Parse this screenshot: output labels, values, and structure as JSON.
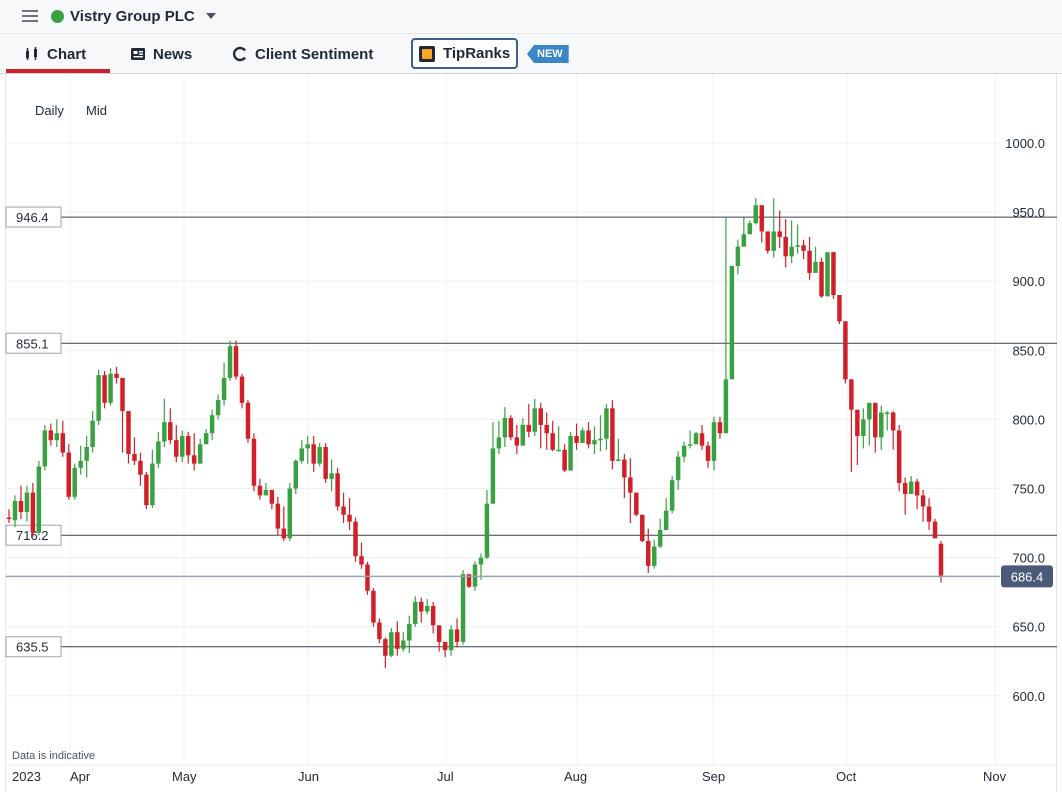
{
  "header": {
    "instrument": "Vistry Group PLC",
    "status_color": "#3aa142"
  },
  "tabs": [
    {
      "label": "Chart",
      "icon": "candlestick-icon",
      "active": true
    },
    {
      "label": "News",
      "icon": "newspaper-icon"
    },
    {
      "label": "Client Sentiment",
      "icon": "sentiment-icon"
    },
    {
      "label": "TipRanks",
      "icon": "tipranks-logo-icon"
    }
  ],
  "new_badge": "NEW",
  "toolbar": {
    "interval": "Daily",
    "price_type": "Mid"
  },
  "disclaimer": "Data is indicative",
  "chart_data": {
    "type": "candlestick",
    "year_label": "2023",
    "x_labels": [
      "Apr",
      "May",
      "Jun",
      "Jul",
      "Aug",
      "Sep",
      "Oct",
      "Nov"
    ],
    "y_ticks": [
      "600.0",
      "650.0",
      "700.0",
      "750.0",
      "800.0",
      "850.0",
      "900.0",
      "950.0",
      "1000.0"
    ],
    "ylim": [
      600,
      1000
    ],
    "horizontal_lines": [
      {
        "label": "946.4",
        "value": 946.4
      },
      {
        "label": "855.1",
        "value": 855.1
      },
      {
        "label": "716.2",
        "value": 716.2
      },
      {
        "label": "635.5",
        "value": 635.5
      }
    ],
    "last_price": {
      "label": "686.4",
      "value": 686.4
    },
    "colors": {
      "up": "#3aa142",
      "down": "#d0202a",
      "last_price_bg": "#4a5a78"
    },
    "candles": [
      [
        729,
        728,
        735,
        725
      ],
      [
        727,
        741,
        745,
        722
      ],
      [
        741,
        733,
        752,
        728
      ],
      [
        733,
        747,
        752,
        726
      ],
      [
        747,
        718,
        754,
        715
      ],
      [
        718,
        766,
        770,
        716
      ],
      [
        766,
        792,
        796,
        763
      ],
      [
        792,
        785,
        797,
        781
      ],
      [
        785,
        790,
        800,
        780
      ],
      [
        790,
        776,
        799,
        773
      ],
      [
        776,
        744,
        782,
        742
      ],
      [
        744,
        765,
        768,
        742
      ],
      [
        765,
        770,
        781,
        760
      ],
      [
        770,
        780,
        788,
        758
      ],
      [
        780,
        799,
        806,
        776
      ],
      [
        799,
        832,
        836,
        796
      ],
      [
        832,
        812,
        835,
        808
      ],
      [
        812,
        833,
        837,
        810
      ],
      [
        833,
        830,
        838,
        826
      ],
      [
        830,
        806,
        810,
        776
      ],
      [
        806,
        775,
        782,
        768
      ],
      [
        775,
        770,
        787,
        767
      ],
      [
        770,
        760,
        776,
        752
      ],
      [
        760,
        738,
        762,
        735
      ],
      [
        738,
        768,
        778,
        736
      ],
      [
        768,
        784,
        791,
        765
      ],
      [
        784,
        798,
        815,
        780
      ],
      [
        798,
        785,
        808,
        782
      ],
      [
        785,
        773,
        796,
        769
      ],
      [
        773,
        788,
        792,
        769
      ],
      [
        788,
        774,
        791,
        768
      ],
      [
        774,
        768,
        790,
        763
      ],
      [
        768,
        782,
        786,
        769
      ],
      [
        782,
        790,
        793,
        783
      ],
      [
        790,
        803,
        807,
        785
      ],
      [
        803,
        814,
        818,
        800
      ],
      [
        814,
        830,
        841,
        810
      ],
      [
        830,
        853,
        857,
        828
      ],
      [
        853,
        831,
        857,
        829
      ],
      [
        831,
        812,
        833,
        808
      ],
      [
        812,
        786,
        814,
        783
      ],
      [
        786,
        752,
        790,
        748
      ],
      [
        752,
        745,
        757,
        742
      ],
      [
        745,
        749,
        754,
        745
      ],
      [
        749,
        739,
        749,
        735
      ],
      [
        739,
        721,
        744,
        716
      ],
      [
        721,
        714,
        737,
        712
      ],
      [
        714,
        750,
        754,
        712
      ],
      [
        750,
        770,
        771,
        746
      ],
      [
        770,
        779,
        785,
        768
      ],
      [
        779,
        782,
        788,
        768
      ],
      [
        782,
        768,
        788,
        762
      ],
      [
        768,
        780,
        783,
        766
      ],
      [
        780,
        757,
        783,
        754
      ],
      [
        757,
        761,
        771,
        748
      ],
      [
        761,
        737,
        765,
        734
      ],
      [
        737,
        731,
        747,
        725
      ],
      [
        731,
        726,
        743,
        720
      ],
      [
        726,
        701,
        729,
        697
      ],
      [
        701,
        695,
        711,
        692
      ],
      [
        695,
        676,
        697,
        673
      ],
      [
        676,
        653,
        678,
        650
      ],
      [
        653,
        641,
        656,
        638
      ],
      [
        641,
        629,
        642,
        620
      ],
      [
        629,
        646,
        649,
        628
      ],
      [
        646,
        634,
        654,
        629
      ],
      [
        634,
        640,
        646,
        632
      ],
      [
        640,
        652,
        658,
        631
      ],
      [
        652,
        668,
        672,
        650
      ],
      [
        668,
        661,
        671,
        653
      ],
      [
        661,
        665,
        670,
        659
      ],
      [
        665,
        651,
        668,
        645
      ],
      [
        651,
        639,
        650,
        632
      ],
      [
        639,
        633,
        638,
        628
      ],
      [
        633,
        648,
        651,
        629
      ],
      [
        648,
        639,
        656,
        635
      ],
      [
        639,
        688,
        691,
        637
      ],
      [
        688,
        679,
        687,
        678
      ],
      [
        679,
        695,
        697,
        676
      ],
      [
        695,
        700,
        703,
        684
      ],
      [
        700,
        739,
        749,
        699
      ],
      [
        739,
        779,
        798,
        777
      ],
      [
        779,
        787,
        799,
        775
      ],
      [
        787,
        801,
        809,
        780
      ],
      [
        801,
        787,
        803,
        785
      ],
      [
        787,
        781,
        796,
        775
      ],
      [
        781,
        796,
        801,
        782
      ],
      [
        796,
        791,
        811,
        787
      ],
      [
        791,
        808,
        815,
        788
      ],
      [
        808,
        796,
        812,
        779
      ],
      [
        796,
        790,
        805,
        778
      ],
      [
        790,
        778,
        799,
        777
      ],
      [
        778,
        778,
        795,
        777
      ],
      [
        778,
        763,
        782,
        762
      ],
      [
        763,
        788,
        791,
        776
      ],
      [
        788,
        783,
        797,
        778
      ],
      [
        783,
        792,
        794,
        783
      ],
      [
        792,
        782,
        798,
        779
      ],
      [
        782,
        785,
        795,
        775
      ],
      [
        785,
        786,
        803,
        777
      ],
      [
        786,
        808,
        811,
        778
      ],
      [
        808,
        770,
        814,
        764
      ],
      [
        770,
        771,
        786,
        770
      ],
      [
        771,
        758,
        775,
        743
      ],
      [
        758,
        747,
        772,
        725
      ],
      [
        747,
        731,
        740,
        730
      ],
      [
        731,
        712,
        730,
        711
      ],
      [
        712,
        694,
        721,
        689
      ],
      [
        694,
        708,
        713,
        692
      ],
      [
        708,
        720,
        728,
        707
      ],
      [
        720,
        734,
        743,
        727
      ],
      [
        734,
        756,
        759,
        732
      ],
      [
        756,
        773,
        777,
        749
      ],
      [
        773,
        781,
        784,
        769
      ],
      [
        781,
        782,
        792,
        779
      ],
      [
        782,
        790,
        791,
        783
      ],
      [
        790,
        781,
        796,
        778
      ],
      [
        781,
        770,
        784,
        765
      ],
      [
        770,
        798,
        802,
        763
      ],
      [
        798,
        790,
        802,
        786
      ],
      [
        790,
        829,
        946,
        827
      ],
      [
        829,
        911,
        911,
        900
      ],
      [
        911,
        925,
        930,
        905
      ],
      [
        925,
        934,
        946,
        930
      ],
      [
        934,
        942,
        944,
        937
      ],
      [
        942,
        955,
        960,
        941
      ],
      [
        955,
        936,
        950,
        928
      ],
      [
        936,
        922,
        935,
        920
      ],
      [
        922,
        936,
        960,
        917
      ],
      [
        936,
        932,
        951,
        924
      ],
      [
        932,
        918,
        945,
        910
      ],
      [
        918,
        925,
        944,
        913
      ],
      [
        925,
        926,
        941,
        920
      ],
      [
        926,
        922,
        930,
        916
      ],
      [
        922,
        906,
        932,
        901
      ],
      [
        906,
        914,
        925,
        907
      ],
      [
        914,
        889,
        917,
        888
      ],
      [
        889,
        921,
        918,
        907
      ],
      [
        921,
        890,
        921,
        887
      ],
      [
        890,
        871,
        870,
        869
      ],
      [
        871,
        829,
        835,
        826
      ],
      [
        829,
        807,
        818,
        762
      ],
      [
        807,
        788,
        799,
        767
      ],
      [
        788,
        800,
        808,
        779
      ],
      [
        800,
        812,
        810,
        781
      ],
      [
        812,
        787,
        808,
        776
      ],
      [
        787,
        805,
        810,
        778
      ],
      [
        805,
        805,
        806,
        792
      ],
      [
        805,
        792,
        806,
        778
      ],
      [
        792,
        754,
        796,
        748
      ],
      [
        754,
        746,
        758,
        731
      ],
      [
        746,
        755,
        759,
        748
      ],
      [
        755,
        745,
        757,
        735
      ],
      [
        745,
        737,
        749,
        726
      ],
      [
        737,
        726,
        743,
        720
      ],
      [
        726,
        714,
        728,
        716
      ],
      [
        710,
        687,
        712,
        682
      ]
    ]
  }
}
